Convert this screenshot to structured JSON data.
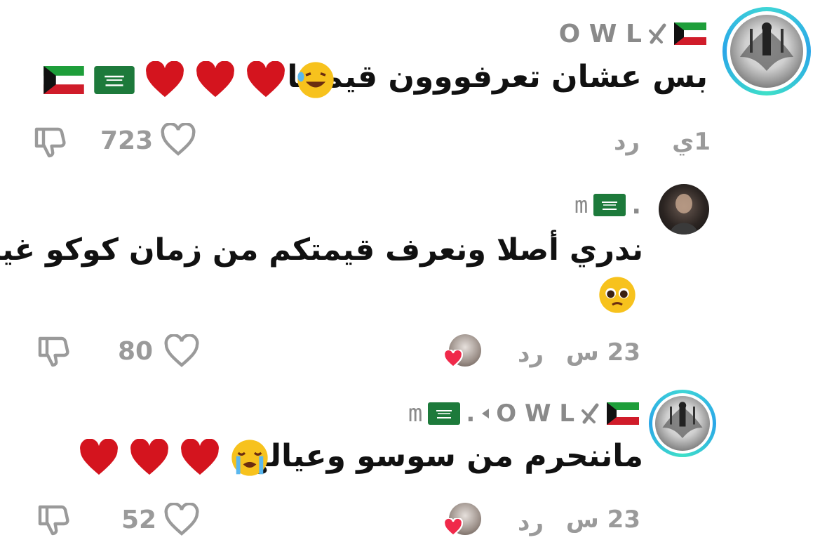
{
  "comments": [
    {
      "username": "O W L",
      "text": "بس عشان تعرفووون قيمتنا",
      "emojis": "🤣❤️❤️❤️",
      "time": "1ي",
      "reply_label": "رد",
      "likes": "723"
    },
    {
      "username": "m",
      "username_prefix": ".",
      "text_line1": "ندري أصلا ونعرف قيمتكم من زمان كوكو غير",
      "text_line2": "🥺",
      "time": "23 س",
      "reply_label": "رد",
      "likes": "80"
    },
    {
      "username": "O W L",
      "reply_to": "m",
      "reply_prefix": ".",
      "text": "ماننحرم من سوسو وعيالها",
      "emojis": "😭❤️❤️❤️",
      "time": "23 س",
      "reply_label": "رد",
      "likes": "52"
    }
  ],
  "colors": {
    "meta_gray": "#9a9a9a",
    "username_gray": "#8a8a8a",
    "heart_red": "#d4141e",
    "avatar_ring": "#2aa6e8"
  },
  "icons": [
    "heart-icon",
    "dislike-icon",
    "kuwait-flag",
    "saudi-flag",
    "red-heart-icon",
    "slash-icon",
    "triangle-right-icon"
  ]
}
